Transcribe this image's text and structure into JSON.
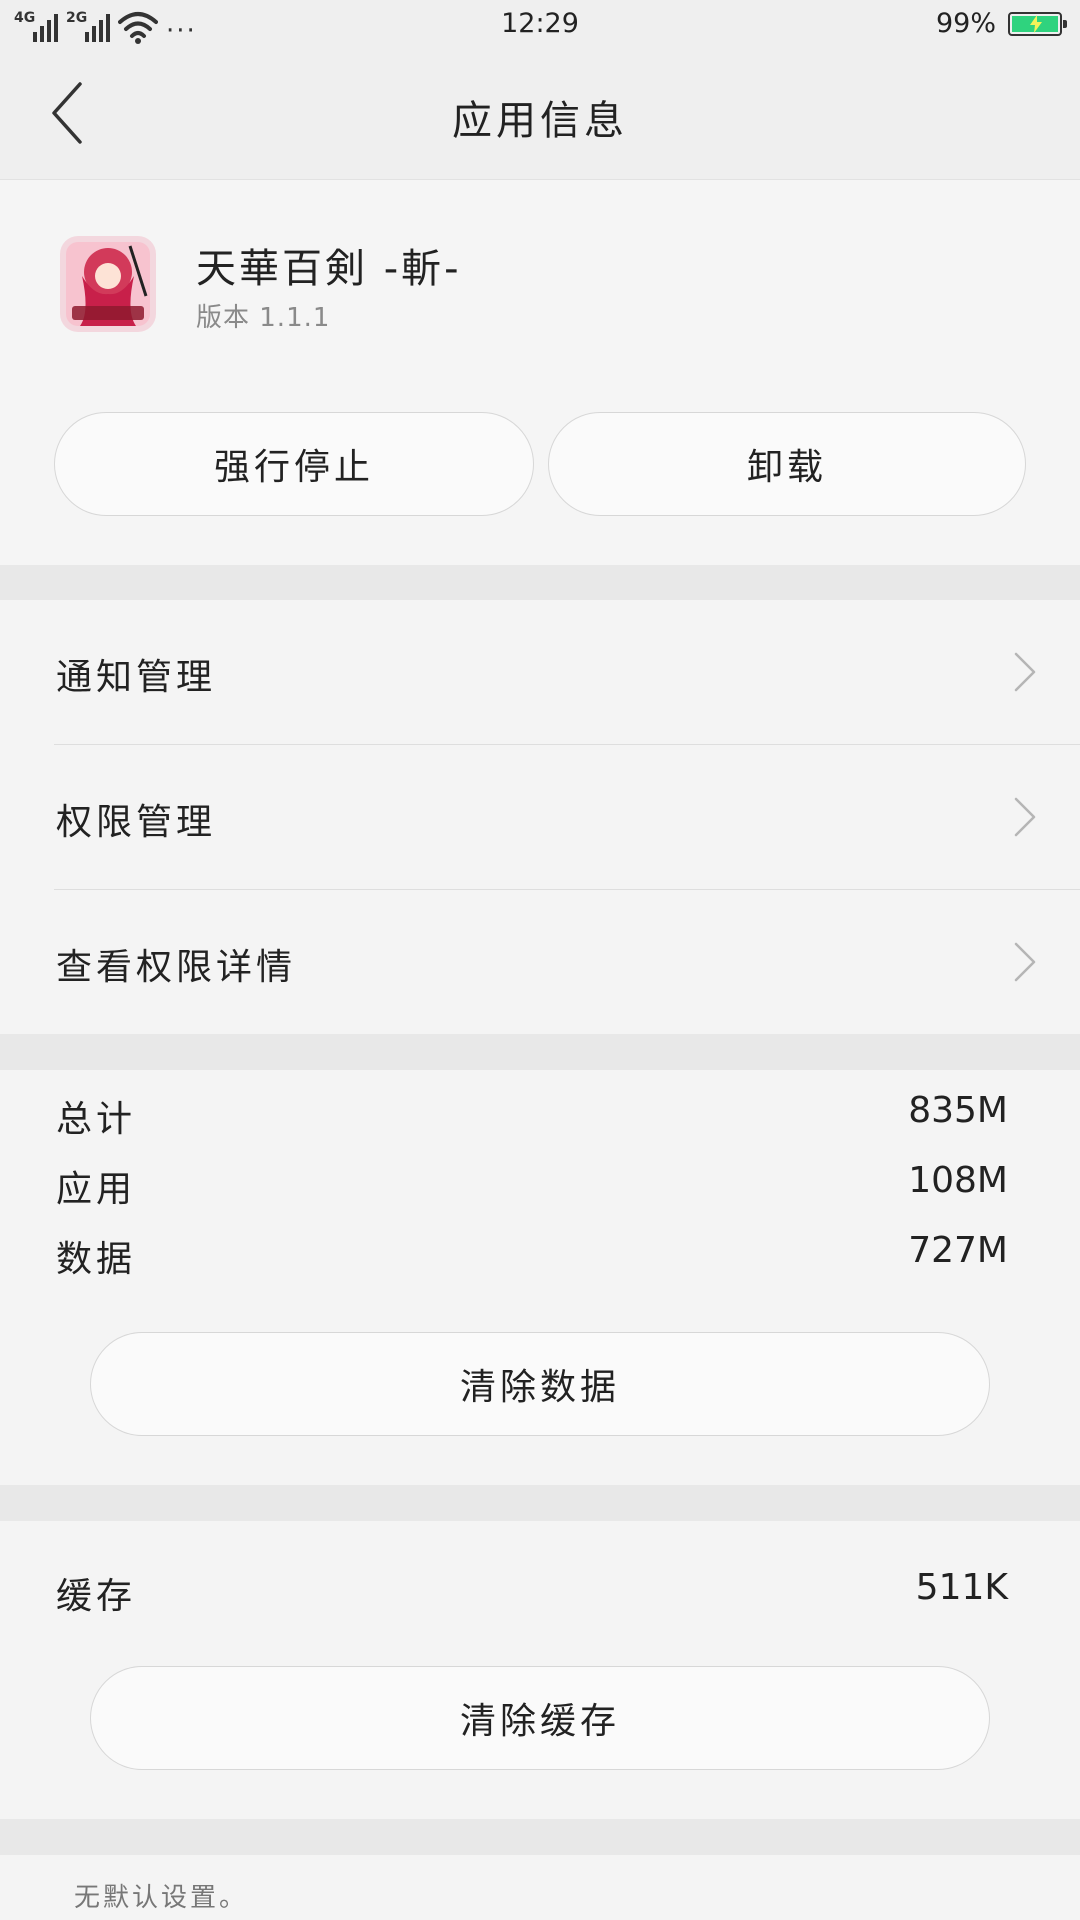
{
  "status_bar": {
    "network_1": "4G",
    "network_2": "2G",
    "more": "···",
    "time": "12:29",
    "battery_percent": "99%",
    "battery_level": 0.99,
    "battery_color": "#2fd37e"
  },
  "nav": {
    "back_icon": "chevron-left-icon",
    "title": "应用信息"
  },
  "app": {
    "name": "天華百剣 -斬-",
    "version": "版本 1.1.1",
    "buttons": {
      "force_stop": "强行停止",
      "uninstall": "卸载"
    }
  },
  "menu": {
    "items": [
      {
        "label": "通知管理",
        "icon": "chevron-right-icon"
      },
      {
        "label": "权限管理",
        "icon": "chevron-right-icon"
      },
      {
        "label": "查看权限详情",
        "icon": "chevron-right-icon"
      }
    ]
  },
  "storage": {
    "rows": [
      {
        "label": "总计",
        "value": "835M"
      },
      {
        "label": "应用",
        "value": "108M"
      },
      {
        "label": "数据",
        "value": "727M"
      }
    ],
    "clear_data": "清除数据"
  },
  "cache": {
    "label": "缓存",
    "value": "511K",
    "clear_cache": "清除缓存"
  },
  "defaults": {
    "note": "无默认设置。"
  }
}
